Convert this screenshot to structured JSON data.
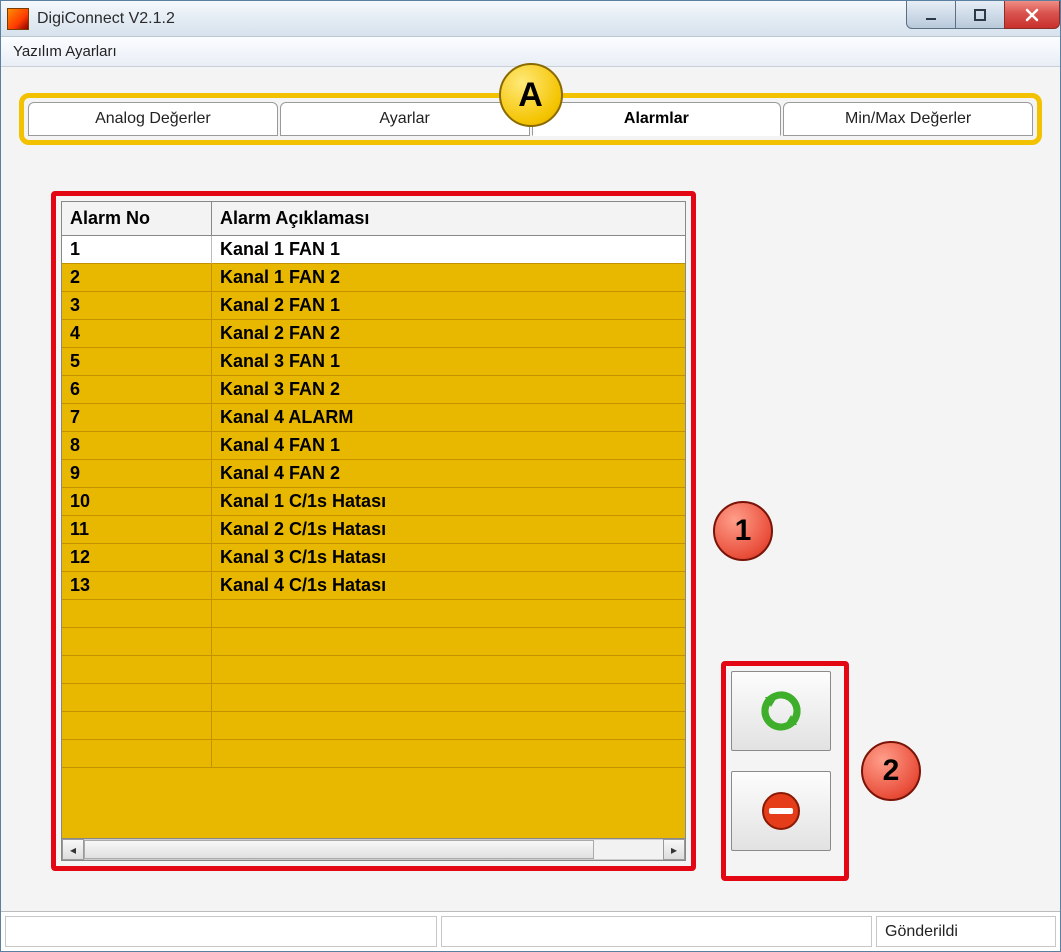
{
  "window": {
    "title": "DigiConnect V2.1.2"
  },
  "menubar": {
    "items": [
      {
        "label": "Yazılım Ayarları"
      }
    ]
  },
  "tabs": [
    {
      "label": "Analog Değerler",
      "active": false
    },
    {
      "label": "Ayarlar",
      "active": false
    },
    {
      "label": "Alarmlar",
      "active": true
    },
    {
      "label": "Min/Max Değerler",
      "active": false
    }
  ],
  "alarms_table": {
    "headers": {
      "no": "Alarm No",
      "desc": "Alarm Açıklaması"
    },
    "rows": [
      {
        "no": "1",
        "desc": "Kanal 1 FAN 1"
      },
      {
        "no": "2",
        "desc": "Kanal 1 FAN 2"
      },
      {
        "no": "3",
        "desc": "Kanal 2 FAN 1"
      },
      {
        "no": "4",
        "desc": "Kanal 2 FAN 2"
      },
      {
        "no": "5",
        "desc": "Kanal 3 FAN 1"
      },
      {
        "no": "6",
        "desc": "Kanal 3 FAN 2"
      },
      {
        "no": "7",
        "desc": "Kanal 4 ALARM"
      },
      {
        "no": "8",
        "desc": "Kanal 4 FAN 1"
      },
      {
        "no": "9",
        "desc": "Kanal 4 FAN 2"
      },
      {
        "no": "10",
        "desc": "Kanal 1 C/1s Hatası"
      },
      {
        "no": "11",
        "desc": "Kanal 2 C/1s Hatası"
      },
      {
        "no": "12",
        "desc": "Kanal 3 C/1s Hatası"
      },
      {
        "no": "13",
        "desc": "Kanal 4 C/1s Hatası"
      }
    ],
    "empty_row_count": 6
  },
  "side_buttons": {
    "refresh": "refresh-icon",
    "clear": "stop-icon"
  },
  "statusbar": {
    "left": "",
    "middle": "",
    "right": "Gönderildi"
  },
  "annotations": {
    "A": "A",
    "one": "1",
    "two": "2"
  }
}
